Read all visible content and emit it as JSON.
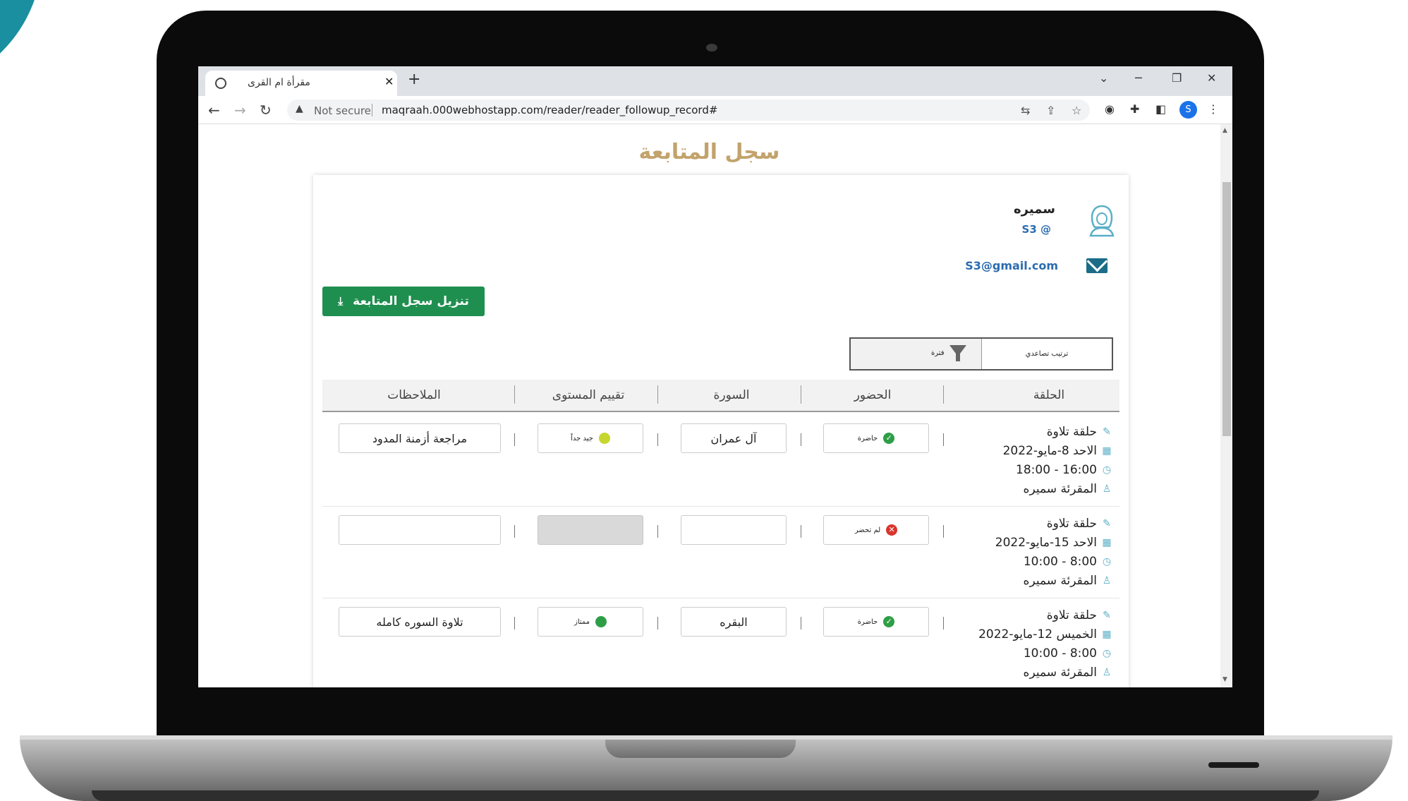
{
  "browser": {
    "tab_title": "مقرأة ام القرى",
    "not_secure": "Not secure",
    "url": "maqraah.000webhostapp.com/reader/reader_followup_record#",
    "profile_initial": "S"
  },
  "page": {
    "title": "سجل المتابعة"
  },
  "user": {
    "name": "سميره",
    "handle": "S3 @",
    "email": "S3@gmail.com"
  },
  "download_button": "تنزيل سجل المتابعة",
  "filter": {
    "sort_label": "ترتيب تصاعدي",
    "filter_label": "فترة"
  },
  "table": {
    "headers": {
      "session": "الحلقة",
      "attendance": "الحضور",
      "surah": "السورة",
      "level": "تقييم المستوى",
      "notes": "الملاحظات"
    },
    "rows": [
      {
        "session": "حلقة تلاوة",
        "date": "الاحد 8-مايو-2022",
        "time": "16:00 - 18:00",
        "reader": "المقرئة سميره",
        "attendance": "حاضرة",
        "surah": "آل عمران",
        "level": "جيد جداً",
        "level_color": "#c6d62e",
        "notes": "مراجعة أزمنة المدود"
      },
      {
        "session": "حلقة تلاوة",
        "date": "الاحد 15-مايو-2022",
        "time": "8:00 - 10:00",
        "reader": "المقرئة سميره",
        "attendance": "لم تحضر",
        "surah": "",
        "level": "",
        "notes": ""
      },
      {
        "session": "حلقة تلاوة",
        "date": "الخميس 12-مايو-2022",
        "time": "8:00 - 10:00",
        "reader": "المقرئة سميره",
        "attendance": "حاضرة",
        "surah": "البقره",
        "level": "ممتاز",
        "level_color": "#2e9e46",
        "notes": "تلاوة السوره كامله"
      }
    ]
  },
  "colors": {
    "accent_title": "#c2a36b",
    "button_green": "#1f8f4f",
    "link_blue": "#2b6cb0",
    "icon_teal": "#5aafc7"
  }
}
